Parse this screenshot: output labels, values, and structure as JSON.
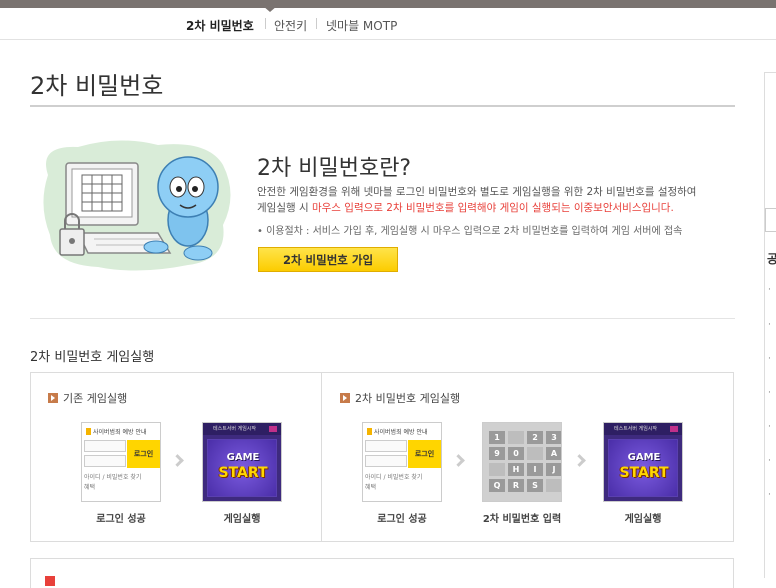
{
  "subnav": {
    "items": [
      {
        "label": "2차 비밀번호",
        "active": true
      },
      {
        "label": "안전키",
        "active": false
      },
      {
        "label": "넷마블 MOTP",
        "active": false
      }
    ]
  },
  "page": {
    "title": "2차 비밀번호"
  },
  "intro": {
    "heading": "2차 비밀번호란?",
    "line1": "안전한 게임환경을 위해 넷마블 로그인 비밀번호와 별도로 게임실행을 위한 2차 비밀번호를 설정하여",
    "line2_prefix": "게임실행 시 ",
    "line2_highlight": "마우스 입력으로 2차 비밀번호를 입력해야 게임이 실행되는 이중보안서비스입니다.",
    "procedure": "• 이용절차 : 서비스 가입 후, 게임실행 시 마우스 입력으로 2차 비밀번호를 입력하여 게임 서버에 접속",
    "join_button": "2차 비밀번호 가입"
  },
  "flow_section": {
    "heading": "2차 비밀번호 게임실행",
    "left": {
      "title": "기존 게임실행",
      "steps": [
        "로그인 성공",
        "게임실행"
      ]
    },
    "right": {
      "title": "2차 비밀번호 게임실행",
      "steps": [
        "로그인 성공",
        "2차 비밀번호 입력",
        "게임실행"
      ]
    }
  },
  "login_mini": {
    "header": "사이버범죄 예방 안내",
    "button": "로그인",
    "footer_line1": "아이디 / 비밀번호 찾기",
    "footer_line2": "혜택"
  },
  "game_mini": {
    "bar": "테스트서버 게임시작",
    "game": "GAME",
    "start": "START"
  },
  "keypad": {
    "keys": [
      "1",
      "",
      "2",
      "3",
      "9",
      "0",
      "",
      "A",
      "",
      "H",
      "I",
      "J",
      "Q",
      "R",
      "S",
      ""
    ]
  },
  "right_panel": {
    "heading": "공"
  }
}
